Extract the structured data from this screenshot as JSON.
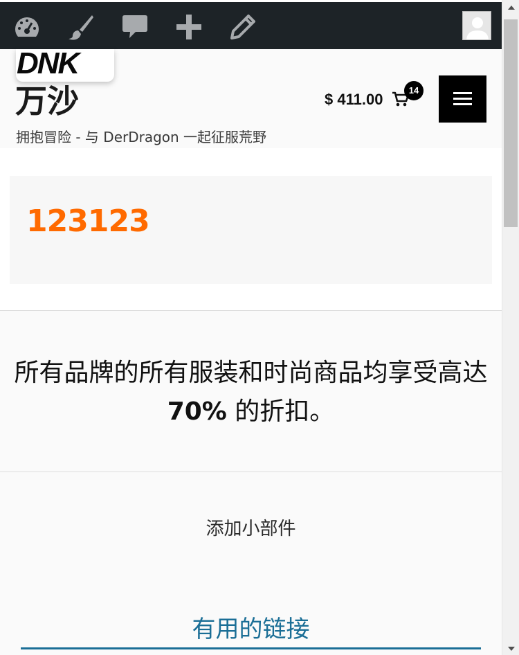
{
  "admin_bar": {
    "icons": [
      "dashboard-icon",
      "customize-brush-icon",
      "comments-icon",
      "new-content-icon",
      "edit-pencil-icon"
    ],
    "avatar": "user-avatar-icon"
  },
  "header": {
    "logo_text": "DNK",
    "site_title": "万沙",
    "tagline": "拥抱冒险 - 与 DerDragon 一起征服荒野",
    "cart_total": "$ 411.00",
    "cart_count": "14"
  },
  "promo": {
    "number": "123123",
    "number_color": "#ff6a00"
  },
  "offer": {
    "text_before": "所有品牌的所有服装和时尚商品均享受高达 ",
    "highlight": "70%",
    "text_after": " 的折扣。"
  },
  "widget": {
    "add_widget_label": "添加小部件"
  },
  "footer": {
    "useful_links_heading": "有用的链接",
    "heading_color": "#1a6e96"
  }
}
